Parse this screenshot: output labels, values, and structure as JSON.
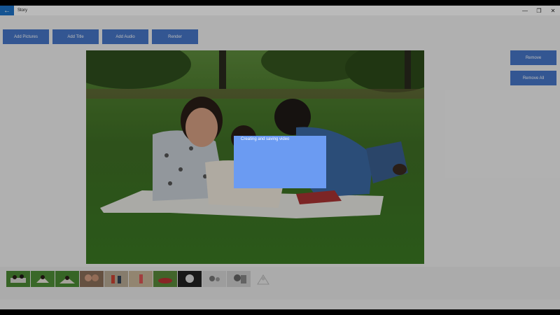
{
  "window": {
    "title": "Story"
  },
  "titlebar": {
    "back_icon": "arrow-left-icon",
    "minimize_glyph": "—",
    "restore_glyph": "❐",
    "close_glyph": "✕"
  },
  "toolbar": {
    "add_pictures_label": "Add Pictures",
    "add_title_label": "Add Title",
    "add_audio_label": "Add Audio",
    "render_label": "Render"
  },
  "side_actions": {
    "remove_label": "Remove",
    "remove_all_label": "Remove All"
  },
  "preview": {
    "image_icon": "family-photo-icon"
  },
  "thumbnails": {
    "count_visible": 10,
    "add_placeholder_icon": "image-placeholder-icon"
  },
  "progress_dialog": {
    "message": "Creating and saving video"
  },
  "colors": {
    "accent": "#1e73c8",
    "button_bg": "#4777c8",
    "dialog_bg": "#6b9bf2",
    "grass": "#3f7a29"
  }
}
